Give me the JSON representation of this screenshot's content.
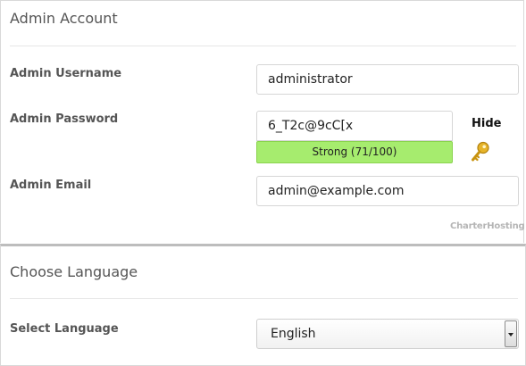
{
  "admin_account": {
    "title": "Admin Account",
    "username_label": "Admin Username",
    "username_value": "administrator",
    "password_label": "Admin Password",
    "password_value": "6_T2c@9cC[x",
    "strength_text": "Strong (71/100)",
    "strength_score": 71,
    "hide_label": "Hide",
    "email_label": "Admin Email",
    "email_value": "admin@example.com",
    "brand_text": "CharterHosting"
  },
  "language": {
    "title": "Choose Language",
    "select_label": "Select Language",
    "selected_value": "English"
  },
  "colors": {
    "strength_fill": "#a6ec6e",
    "key_icon": "#d9a21b"
  },
  "icons": {
    "reveal_password": "key-icon",
    "dropdown": "chevron-down-icon"
  }
}
